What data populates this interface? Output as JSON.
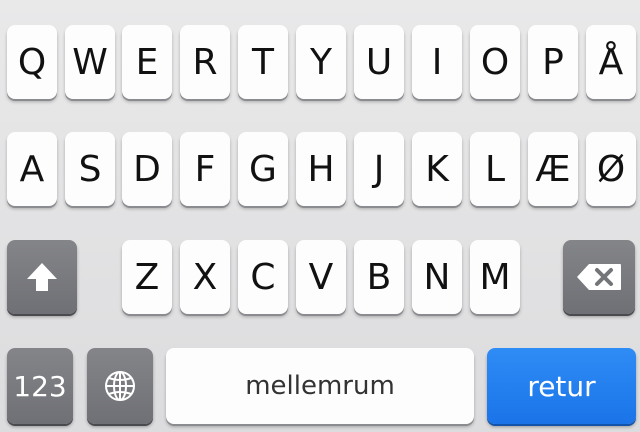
{
  "keyboard": {
    "row1": [
      "Q",
      "W",
      "E",
      "R",
      "T",
      "Y",
      "U",
      "I",
      "O",
      "P",
      "Å"
    ],
    "row2": [
      "A",
      "S",
      "D",
      "F",
      "G",
      "H",
      "J",
      "K",
      "L",
      "Æ",
      "Ø"
    ],
    "row3": [
      "Z",
      "X",
      "C",
      "V",
      "B",
      "N",
      "M"
    ],
    "shift_icon": "shift-arrow-icon",
    "backspace_icon": "backspace-icon",
    "numbers_label": "123",
    "globe_icon": "globe-icon",
    "space_label": "mellemrum",
    "return_label": "retur",
    "colors": {
      "key_bg": "#fdfdfd",
      "special_key_bg": "#7a7b80",
      "return_bg": "#2680ee",
      "background": "#e3e3e5"
    }
  }
}
